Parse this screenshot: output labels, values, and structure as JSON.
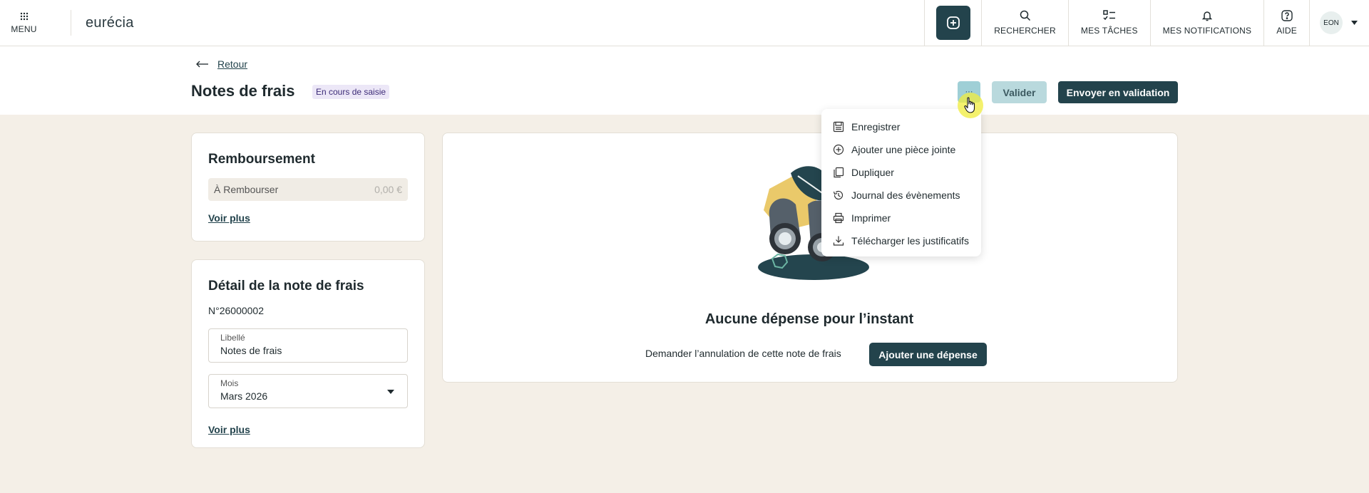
{
  "topbar": {
    "menu_label": "MENU",
    "logo": "eurécia",
    "nav": {
      "search": "RECHERCHER",
      "tasks": "MES TÂCHES",
      "notifications": "MES NOTIFICATIONS",
      "help": "AIDE"
    },
    "avatar_initials": "EON"
  },
  "header": {
    "back_label": "Retour",
    "title": "Notes de frais",
    "status": "En cours de saisie",
    "more_label": "···",
    "validate_label": "Valider",
    "send_label": "Envoyer en validation"
  },
  "reimbursement": {
    "title": "Remboursement",
    "amount_label": "À Rembourser",
    "amount_value": "0,00 €",
    "more_link": "Voir plus"
  },
  "detail": {
    "title": "Détail de la note de frais",
    "number": "N°26000002",
    "label_field": {
      "label": "Libellé",
      "value": "Notes de frais"
    },
    "month_field": {
      "label": "Mois",
      "value": "Mars 2026"
    },
    "more_link": "Voir plus"
  },
  "empty_state": {
    "title": "Aucune dépense pour l’instant",
    "cancel_link": "Demander l’annulation de cette note de frais",
    "add_button": "Ajouter une dépense"
  },
  "dropdown": {
    "items": [
      {
        "label": "Enregistrer",
        "icon": "save-icon"
      },
      {
        "label": "Ajouter une pièce jointe",
        "icon": "plus-circle-icon"
      },
      {
        "label": "Dupliquer",
        "icon": "copy-icon"
      },
      {
        "label": "Journal des évènements",
        "icon": "history-icon"
      },
      {
        "label": "Imprimer",
        "icon": "printer-icon"
      },
      {
        "label": "Télécharger les justificatifs",
        "icon": "download-icon"
      }
    ]
  },
  "colors": {
    "primary": "#23434c",
    "background": "#f4efe7",
    "status_badge_bg": "#ece7f7",
    "accent_light": "#9fcfd6"
  }
}
